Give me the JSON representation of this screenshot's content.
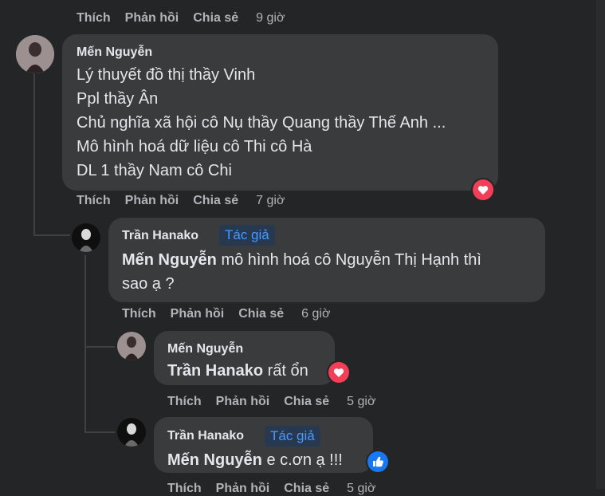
{
  "top_actions": {
    "like": "Thích",
    "reply": "Phản hồi",
    "share": "Chia sẻ",
    "time": "9 giờ"
  },
  "c1": {
    "author": "Mến Nguyễn",
    "lines": [
      "Lý thuyết đồ thị thầy Vinh",
      "Ppl thầy Ân",
      "Chủ nghĩa xã hội cô Nụ thầy Quang thầy Thế Anh ...",
      "Mô hình hoá dữ liệu cô Thi cô Hà",
      "DL 1 thầy Nam cô Chi"
    ],
    "reaction": "heart-reaction-icon",
    "actions": {
      "like": "Thích",
      "reply": "Phản hồi",
      "share": "Chia sẻ",
      "time": "7 giờ"
    }
  },
  "c2": {
    "author": "Trần Hanako",
    "badge": "Tác giả",
    "mention": "Mến Nguyễn",
    "text1": " mô hình hoá cô Nguyễn Thị Hạnh thì",
    "text2": "sao ạ ?",
    "actions": {
      "like": "Thích",
      "reply": "Phản hồi",
      "share": "Chia sẻ",
      "time": "6 giờ"
    }
  },
  "c3": {
    "author": "Mến Nguyễn",
    "mention": "Trần Hanako",
    "text": " rất ổn",
    "reaction": "heart-reaction-icon",
    "actions": {
      "like": "Thích",
      "reply": "Phản hồi",
      "share": "Chia sẻ",
      "time": "5 giờ"
    }
  },
  "c4": {
    "author": "Trần Hanako",
    "badge": "Tác giả",
    "mention": "Mến Nguyễn",
    "text": " e c.ơn ạ !!!",
    "reaction": "like-reaction-icon",
    "actions": {
      "like": "Thích",
      "reply": "Phản hồi",
      "share": "Chia sẻ",
      "time": "5 giờ"
    }
  },
  "colors": {
    "background": "#242526",
    "bubble": "#3a3b3c",
    "text": "#e4e6eb",
    "secondary": "#b0b3b8",
    "badge_bg": "#263951",
    "badge_text": "#4599ff",
    "heart": "#f33e58",
    "like": "#1877f2"
  }
}
